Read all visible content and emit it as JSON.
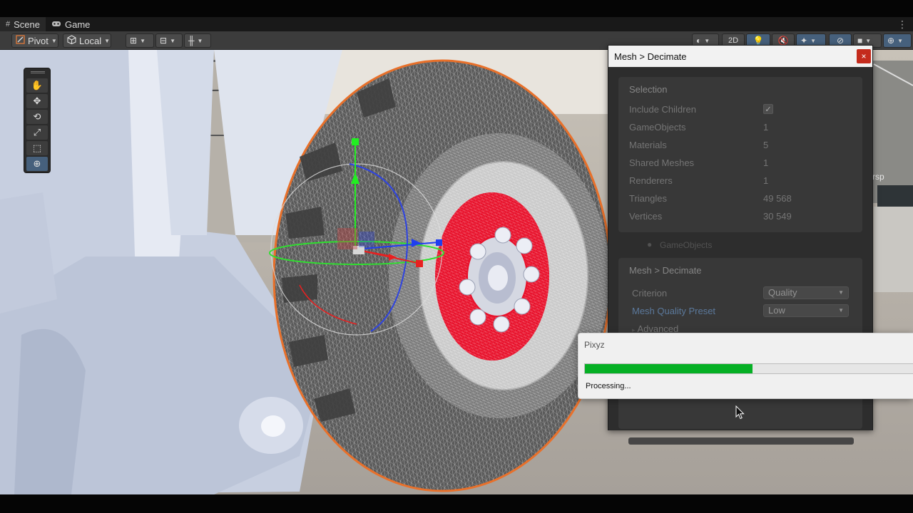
{
  "tabs": [
    {
      "label": "Scene",
      "icon": "grid-icon"
    },
    {
      "label": "Game",
      "icon": "gamepad-icon"
    }
  ],
  "toolbar": {
    "pivot_label": "Pivot",
    "local_label": "Local",
    "view_2d_label": "2D"
  },
  "palette": {
    "tools": [
      "hand-tool",
      "move-tool",
      "rotate-tool",
      "scale-tool",
      "rect-tool",
      "transform-tool"
    ],
    "active_tool": "transform-tool"
  },
  "scene": {
    "persp_label": "rsp"
  },
  "decimate_window": {
    "title": "Mesh > Decimate",
    "close_label": "×",
    "selection": {
      "title": "Selection",
      "include_children_label": "Include Children",
      "include_children_checked": true,
      "rows": [
        {
          "label": "GameObjects",
          "value": "1"
        },
        {
          "label": "Materials",
          "value": "5"
        },
        {
          "label": "Shared Meshes",
          "value": "1"
        },
        {
          "label": "Renderers",
          "value": "1"
        },
        {
          "label": "Triangles",
          "value": "49 568"
        },
        {
          "label": "Vertices",
          "value": "30 549"
        }
      ]
    },
    "ghost_node_label": "GameObjects",
    "decimate": {
      "title": "Mesh > Decimate",
      "criterion_label": "Criterion",
      "criterion_value": "Quality",
      "preset_label": "Mesh Quality Preset",
      "preset_value": "Low",
      "advanced_label": "Advanced"
    }
  },
  "progress_dialog": {
    "title": "Pixyz",
    "status": "Processing...",
    "progress_fraction": 0.51
  },
  "colors": {
    "accent_blue": "#46607c",
    "progress_green": "#06b025",
    "close_red": "#c42b1c",
    "selection_outline": "#e8702a",
    "rim_red": "#e8102a"
  }
}
